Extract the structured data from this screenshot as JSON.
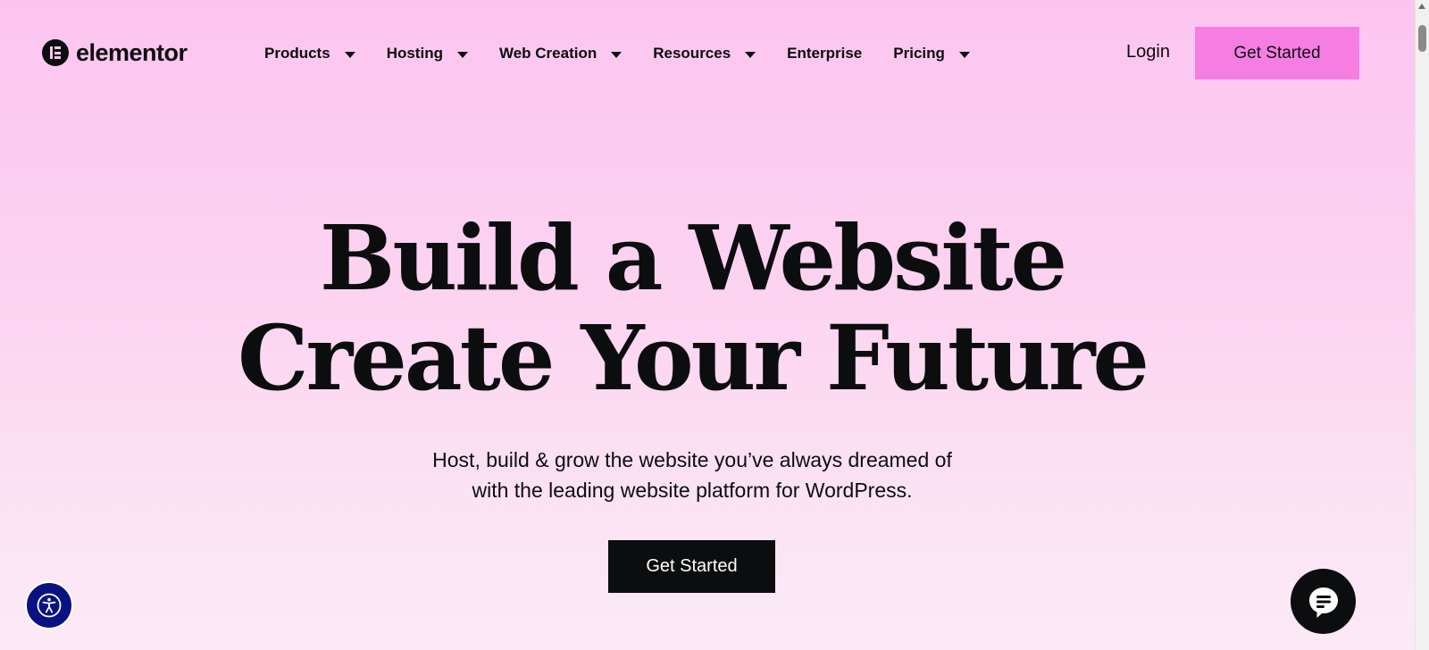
{
  "brand": {
    "name": "elementor",
    "logo_icon": "elementor-e-icon"
  },
  "nav": {
    "items": [
      {
        "label": "Products",
        "has_dropdown": true
      },
      {
        "label": "Hosting",
        "has_dropdown": true
      },
      {
        "label": "Web Creation",
        "has_dropdown": true
      },
      {
        "label": "Resources",
        "has_dropdown": true
      },
      {
        "label": "Enterprise",
        "has_dropdown": false
      },
      {
        "label": "Pricing",
        "has_dropdown": true
      }
    ],
    "login_label": "Login",
    "cta_label": "Get Started"
  },
  "hero": {
    "title_line1": "Build a Website",
    "title_line2": "Create Your Future",
    "subtitle_line1": "Host, build & grow the website you’ve always dreamed of",
    "subtitle_line2": "with the leading website platform for WordPress.",
    "cta_label": "Get Started"
  },
  "widgets": {
    "accessibility_icon": "accessibility-icon",
    "chat_icon": "chat-icon"
  },
  "colors": {
    "background_top": "#fcc5f1",
    "background_bottom": "#fbeaf6",
    "header_cta": "#f67ee3",
    "hero_cta": "#0c0d0e",
    "accessibility": "#0a1282",
    "text": "#0c0d0e"
  }
}
